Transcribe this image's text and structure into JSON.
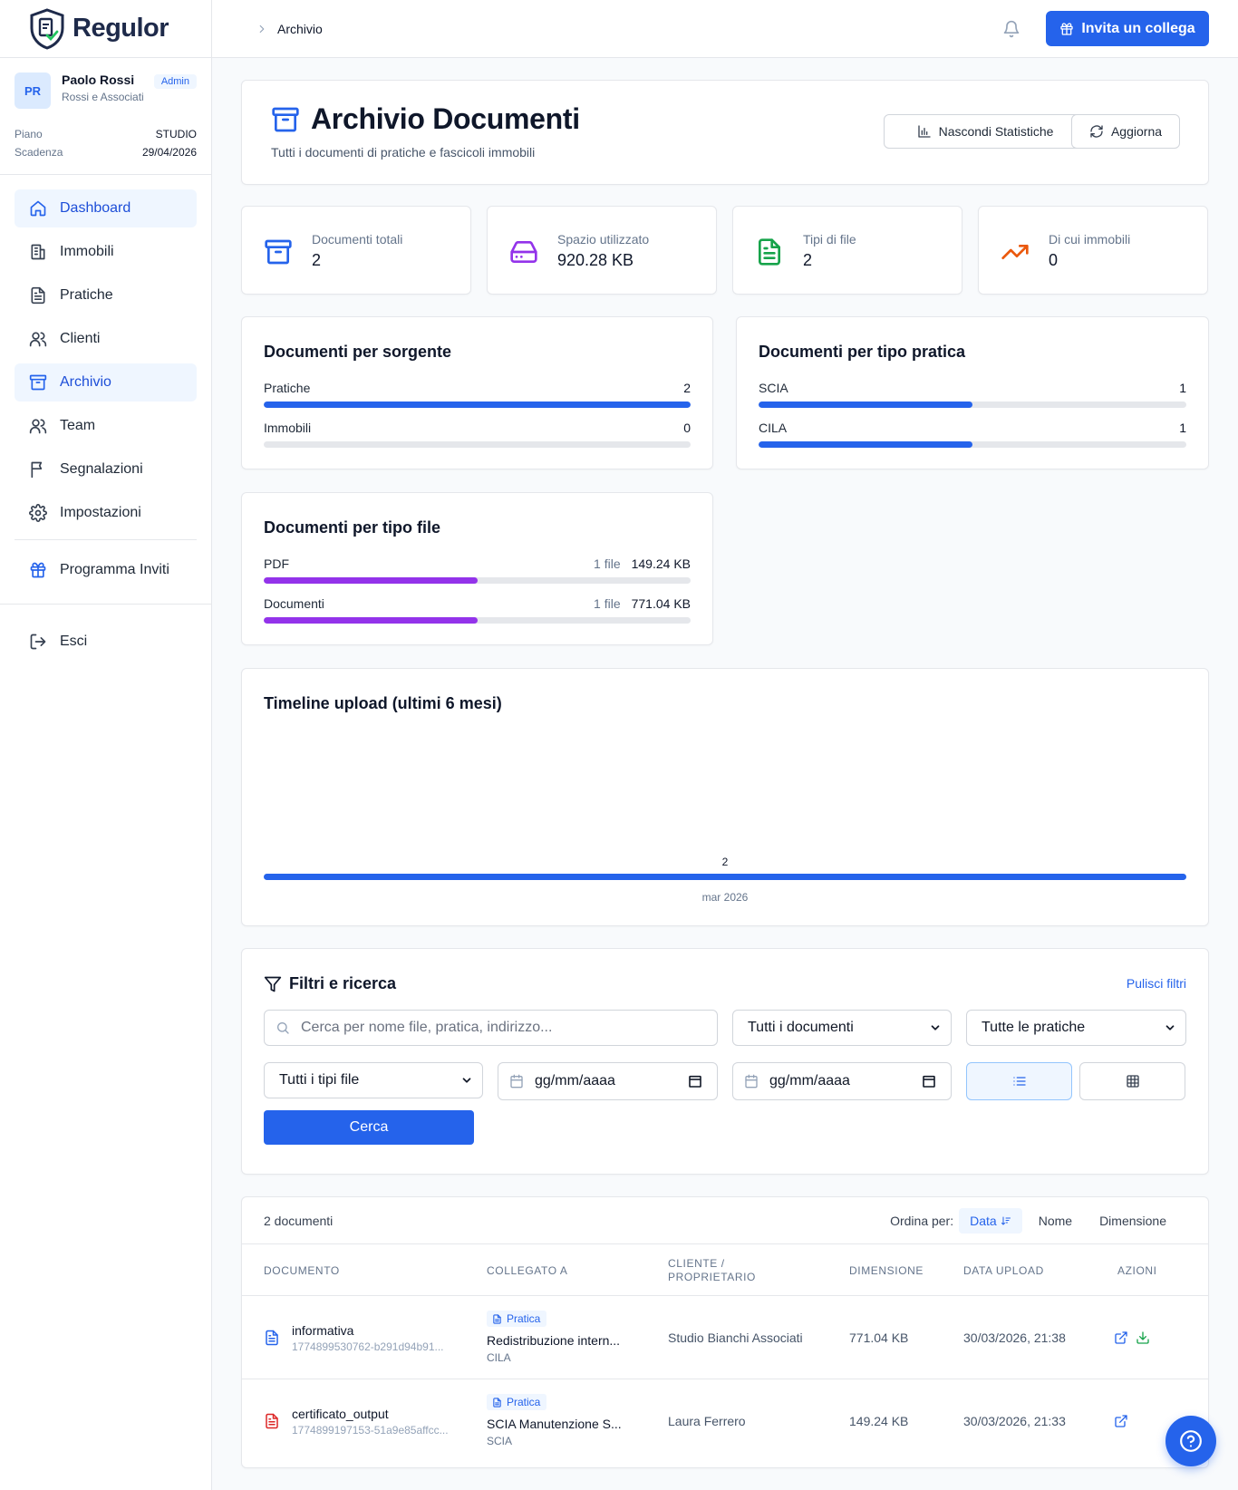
{
  "brand": {
    "name": "Regulor"
  },
  "user": {
    "initials": "PR",
    "name": "Paolo Rossi",
    "org": "Rossi e Associati",
    "role": "Admin"
  },
  "plan": {
    "plan_label": "Piano",
    "plan_value": "STUDIO",
    "expiry_label": "Scadenza",
    "expiry_value": "29/04/2026"
  },
  "nav": {
    "items": [
      {
        "label": "Dashboard",
        "icon": "home-icon",
        "active": true
      },
      {
        "label": "Immobili",
        "icon": "building-icon"
      },
      {
        "label": "Pratiche",
        "icon": "file-text-icon"
      },
      {
        "label": "Clienti",
        "icon": "users-icon"
      },
      {
        "label": "Archivio",
        "icon": "archive-icon",
        "active": true
      },
      {
        "label": "Team",
        "icon": "users-icon"
      },
      {
        "label": "Segnalazioni",
        "icon": "flag-icon"
      },
      {
        "label": "Impostazioni",
        "icon": "gear-icon"
      }
    ],
    "invite_program": "Programma Inviti",
    "logout": "Esci"
  },
  "topbar": {
    "breadcrumb": "Archivio",
    "invite_button": "Invita un collega"
  },
  "header": {
    "title": "Archivio Documenti",
    "subtitle": "Tutti i documenti di pratiche e fascicoli immobili",
    "hide_stats": "Nascondi Statistiche",
    "refresh": "Aggiorna"
  },
  "stats": [
    {
      "label": "Documenti totali",
      "value": "2",
      "icon": "archive-icon",
      "color": "#2563eb"
    },
    {
      "label": "Spazio utilizzato",
      "value": "920.28 KB",
      "icon": "hard-drive-icon",
      "color": "#9333ea"
    },
    {
      "label": "Tipi di file",
      "value": "2",
      "icon": "file-text-icon",
      "color": "#16a34a"
    },
    {
      "label": "Di cui immobili",
      "value": "0",
      "icon": "trending-up-icon",
      "color": "#ea580c"
    }
  ],
  "by_source": {
    "title": "Documenti per sorgente",
    "rows": [
      {
        "label": "Pratiche",
        "count": "2",
        "fraction": 1.0
      },
      {
        "label": "Immobili",
        "count": "0",
        "fraction": 0.0
      }
    ]
  },
  "by_type": {
    "title": "Documenti per tipo pratica",
    "rows": [
      {
        "label": "SCIA",
        "count": "1",
        "fraction": 0.5
      },
      {
        "label": "CILA",
        "count": "1",
        "fraction": 0.5
      }
    ]
  },
  "by_file": {
    "title": "Documenti per tipo file",
    "rows": [
      {
        "label": "PDF",
        "files": "1 file",
        "size": "149.24 KB",
        "fraction": 0.5
      },
      {
        "label": "Documenti",
        "files": "1 file",
        "size": "771.04 KB",
        "fraction": 0.5
      }
    ]
  },
  "timeline": {
    "title": "Timeline upload (ultimi 6 mesi)",
    "count": "2",
    "month": "mar 2026"
  },
  "filters": {
    "title": "Filtri e ricerca",
    "clear": "Pulisci filtri",
    "search_placeholder": "Cerca per nome file, pratica, indirizzo...",
    "doc_select": "Tutti i documenti",
    "practice_select": "Tutte le pratiche",
    "filetype_select": "Tutti i tipi file",
    "date_from": "gg/mm/aaaa",
    "date_to": "gg/mm/aaaa",
    "search_button": "Cerca"
  },
  "table": {
    "count": "2 documenti",
    "sort_label": "Ordina per:",
    "sort_options": [
      "Data",
      "Nome",
      "Dimensione"
    ],
    "headers": [
      "DOCUMENTO",
      "COLLEGATO A",
      "CLIENTE /",
      "PROPRIETARIO",
      "DIMENSIONE",
      "DATA UPLOAD",
      "AZIONI"
    ],
    "rows": [
      {
        "name": "informativa",
        "id": "1774899530762-b291d94b91...",
        "badge": "Pratica",
        "linked": "Redistribuzione intern...",
        "practice_type": "CILA",
        "client": "Studio Bianchi Associati",
        "size": "771.04 KB",
        "date": "30/03/2026, 21:38",
        "file_color": "#2563eb"
      },
      {
        "name": "certificato_output",
        "id": "1774899197153-51a9e85affcc...",
        "badge": "Pratica",
        "linked": "SCIA Manutenzione S...",
        "practice_type": "SCIA",
        "client": "Laura Ferrero",
        "size": "149.24 KB",
        "date": "30/03/2026, 21:33",
        "file_color": "#dc2626"
      }
    ]
  }
}
